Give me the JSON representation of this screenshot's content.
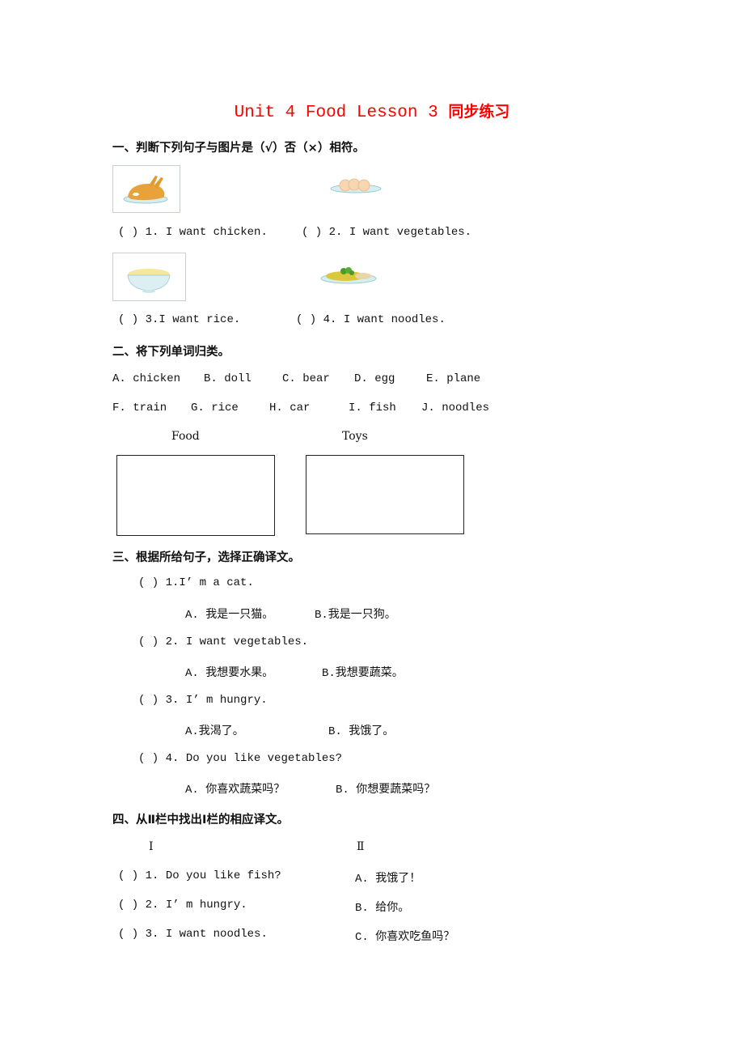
{
  "title": {
    "english": "Unit 4 Food Lesson 3 ",
    "chinese": "同步练习",
    "color": "#ff0000"
  },
  "section1": {
    "heading": "一、判断下列句子与图片是（√）否（×）相符。",
    "items": [
      {
        "bracket": "(   )",
        "text": "1.  I want chicken.",
        "image": "roast-chicken-image"
      },
      {
        "bracket": "(   )",
        "text": "2.  I want vegetables.",
        "image": "plate-of-buns-image"
      },
      {
        "bracket": "(   )",
        "text": "3.I want rice.",
        "image": "bowl-of-rice-image"
      },
      {
        "bracket": "(   )",
        "text": "4.  I want noodles.",
        "image": "plate-of-noodles-image"
      }
    ]
  },
  "section2": {
    "heading": "二、将下列单词归类。",
    "words_row1": [
      "A.  chicken",
      "B.  doll",
      "C.  bear",
      "D.  egg",
      "E.  plane"
    ],
    "words_row2": [
      "F.  train",
      "G.  rice",
      "H.  car",
      "I.  fish",
      "J.  noodles"
    ],
    "categories": [
      "Food",
      "Toys"
    ]
  },
  "section3": {
    "heading": "三、根据所给句子，选择正确译文。",
    "questions": [
      {
        "bracket": "(   )",
        "question": "1.I’ m a cat.",
        "option_a": "A.  我是一只猫。",
        "option_b": "B.我是一只狗。"
      },
      {
        "bracket": "(   )",
        "question": "2.  I want vegetables.",
        "option_a": "A.  我想要水果。",
        "option_b": "B.我想要蔬菜。"
      },
      {
        "bracket": "(   )",
        "question": "3.  I’ m hungry.",
        "option_a": "A.我渴了。",
        "option_b": "B.  我饿了。"
      },
      {
        "bracket": "(   )",
        "question": "4.  Do you like vegetables?",
        "option_a": "A.  你喜欢蔬菜吗？",
        "option_b": "B.  你想要蔬菜吗？"
      }
    ]
  },
  "section4": {
    "heading": "四、从Ⅱ栏中找出Ⅰ栏的相应译文。",
    "col1_header": "Ⅰ",
    "col2_header": "Ⅱ",
    "rows": [
      {
        "bracket": "(   )",
        "left": "1.  Do you like fish?",
        "right": "A.  我饿了！"
      },
      {
        "bracket": "(   )",
        "left": "2.  I’ m hungry.",
        "right": "B.  给你。"
      },
      {
        "bracket": "(   )",
        "left": "3.  I want noodles.",
        "right": "C.  你喜欢吃鱼吗？"
      }
    ]
  }
}
